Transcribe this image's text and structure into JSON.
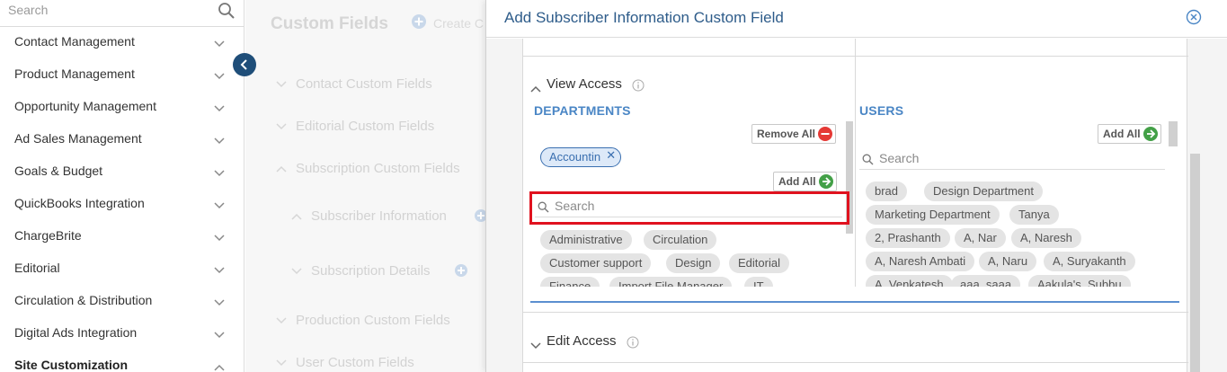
{
  "sidebar": {
    "search_placeholder": "Search",
    "items": [
      {
        "label": "Contact Management",
        "active": false
      },
      {
        "label": "Product Management",
        "active": false
      },
      {
        "label": "Opportunity Management",
        "active": false
      },
      {
        "label": "Ad Sales Management",
        "active": false
      },
      {
        "label": "Goals & Budget",
        "active": false
      },
      {
        "label": "QuickBooks Integration",
        "active": false
      },
      {
        "label": "ChargeBrite",
        "active": false
      },
      {
        "label": "Editorial",
        "active": false
      },
      {
        "label": "Circulation & Distribution",
        "active": false
      },
      {
        "label": "Digital Ads Integration",
        "active": false
      },
      {
        "label": "Site Customization",
        "active": true
      }
    ]
  },
  "background_page": {
    "title": "Custom Fields",
    "create_label": "Create C",
    "sections": [
      {
        "label": "Contact Custom Fields"
      },
      {
        "label": "Editorial Custom Fields"
      },
      {
        "label": "Subscription Custom Fields"
      },
      {
        "label": "Subscriber Information"
      },
      {
        "label": "Subscription Details"
      },
      {
        "label": "Production Custom Fields"
      },
      {
        "label": "User Custom Fields"
      }
    ]
  },
  "modal": {
    "title": "Add Subscriber Information Custom Field",
    "view_access": {
      "title": "View Access",
      "departments": {
        "title": "DEPARTMENTS",
        "remove_all_label": "Remove All",
        "add_all_label": "Add All",
        "selected": [
          "Accountin"
        ],
        "search_placeholder": "Search",
        "available": [
          "Administrative",
          "Circulation",
          "Customer support",
          "Design",
          "Editorial",
          "Finance",
          "Import File Manager",
          "IT"
        ]
      },
      "users": {
        "title": "USERS",
        "add_all_label": "Add All",
        "search_placeholder": "Search",
        "available": [
          "brad",
          "Design Department",
          "Marketing Department",
          "Tanya",
          "2, Prashanth",
          "A, Nar",
          "A, Naresh",
          "A, Naresh Ambati",
          "A, Naru",
          "A, Suryakanth",
          "A, Venkatesh",
          "aaa, saaa",
          "Aakula's, Subbu"
        ]
      }
    },
    "edit_access": {
      "title": "Edit Access"
    }
  },
  "colors": {
    "accent_blue": "#4a86c5",
    "title_blue": "#2e5c8a",
    "highlight_red": "#e0121f",
    "remove_red": "#e53935",
    "add_green": "#43a047"
  }
}
